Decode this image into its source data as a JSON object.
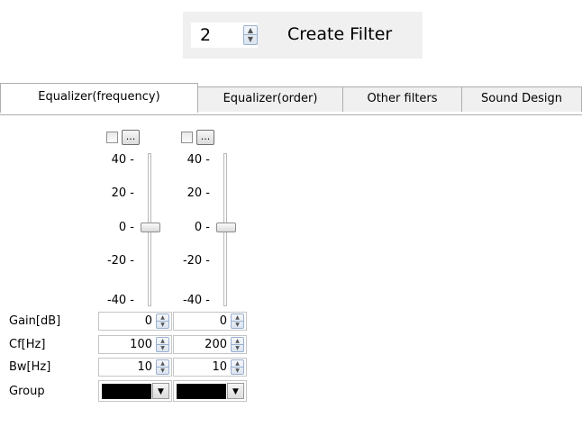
{
  "toolbar": {
    "filter_count": "2",
    "create_filter_label": "Create Filter"
  },
  "tabs": [
    {
      "label": "Equalizer(frequency)",
      "active": true
    },
    {
      "label": "Equalizer(order)",
      "active": false
    },
    {
      "label": "Other filters",
      "active": false
    },
    {
      "label": "Sound Design",
      "active": false
    }
  ],
  "scale": {
    "labels": [
      "40 -",
      "20 -",
      "0 -",
      "-20 -",
      "-40 -"
    ]
  },
  "channel_buttons": {
    "more_label": "..."
  },
  "params": {
    "gain_label": "Gain[dB]",
    "cf_label": "Cf[Hz]",
    "bw_label": "Bw[Hz]",
    "group_label": "Group"
  },
  "channels": [
    {
      "enabled": false,
      "gain": "0",
      "cf": "100",
      "bw": "10",
      "group_color": "#000000",
      "slider_value_db": 0
    },
    {
      "enabled": false,
      "gain": "0",
      "cf": "200",
      "bw": "10",
      "group_color": "#000000",
      "slider_value_db": 0
    }
  ],
  "colors": {
    "tab_border": "#adadad",
    "spin_accent": "#9ab0cf"
  },
  "icons": {
    "spin": "spin-updown-icon",
    "dropdown": "dropdown-arrow-icon"
  }
}
